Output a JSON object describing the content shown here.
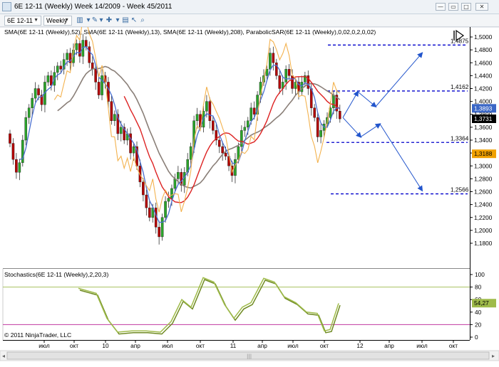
{
  "window": {
    "title": "6E 12-11 (Weekly)  Week 14/2009 - Week 45/2011"
  },
  "toolbar": {
    "instrument": "6E 12-11",
    "period": "Weekly"
  },
  "chart": {
    "indicator_label": "SMA(6E 12-11 (Weekly),52), SMA(6E 12-11 (Weekly),13), SMA(6E 12-11 (Weekly),208), ParabolicSAR(6E 12-11 (Weekly),0,02,0,2,0,02)",
    "copyright": "© 2011 NinjaTrader, LLC",
    "stoch_label": "Stochastics(6E 12-11 (Weekly),2,20,3)",
    "price_axis": [
      "1,5000",
      "1,4800",
      "1,4600",
      "1,4400",
      "1,4200",
      "1,4000",
      "1,3800",
      "1,3600",
      "1,3400",
      "1,3200",
      "1,3000",
      "1,2800",
      "1,2600",
      "1,2400",
      "1,2200",
      "1,2000",
      "1,1800"
    ],
    "stoch_axis": [
      "100",
      "80",
      "60",
      "40",
      "20",
      "0"
    ],
    "time_axis": [
      "июл",
      "окт",
      "10",
      "апр",
      "июл",
      "окт",
      "11",
      "апр",
      "июл",
      "окт",
      "12",
      "апр",
      "июл",
      "окт"
    ],
    "price_tags": [
      {
        "text": "1,3893",
        "color": "#3b67c6"
      },
      {
        "text": "1,3731",
        "color": "#000000"
      },
      {
        "text": "1,3188",
        "color": "#f0a000"
      }
    ],
    "stoch_tag": "54,27",
    "levels": [
      {
        "value": 1.4875,
        "label": "1,4875"
      },
      {
        "value": 1.4162,
        "label": "1,4162"
      },
      {
        "value": 1.3364,
        "label": "1,3364"
      },
      {
        "value": 1.2566,
        "label": "1,2566"
      }
    ],
    "stoch_levels": [
      80,
      20
    ],
    "colors": {
      "up": "#2aa52a",
      "down": "#b40000",
      "sma52": "#dd2222",
      "sma13": "#4a6fd0",
      "sma208": "#8a7f78",
      "sar": "#f3b24e",
      "stoch_k": "#9fbb4a",
      "stoch_d": "#6f8a22",
      "level": "#0000cc",
      "arrow": "#2255cc",
      "stoch_upper": "#a8c060",
      "stoch_lower": "#c038a0"
    }
  }
}
